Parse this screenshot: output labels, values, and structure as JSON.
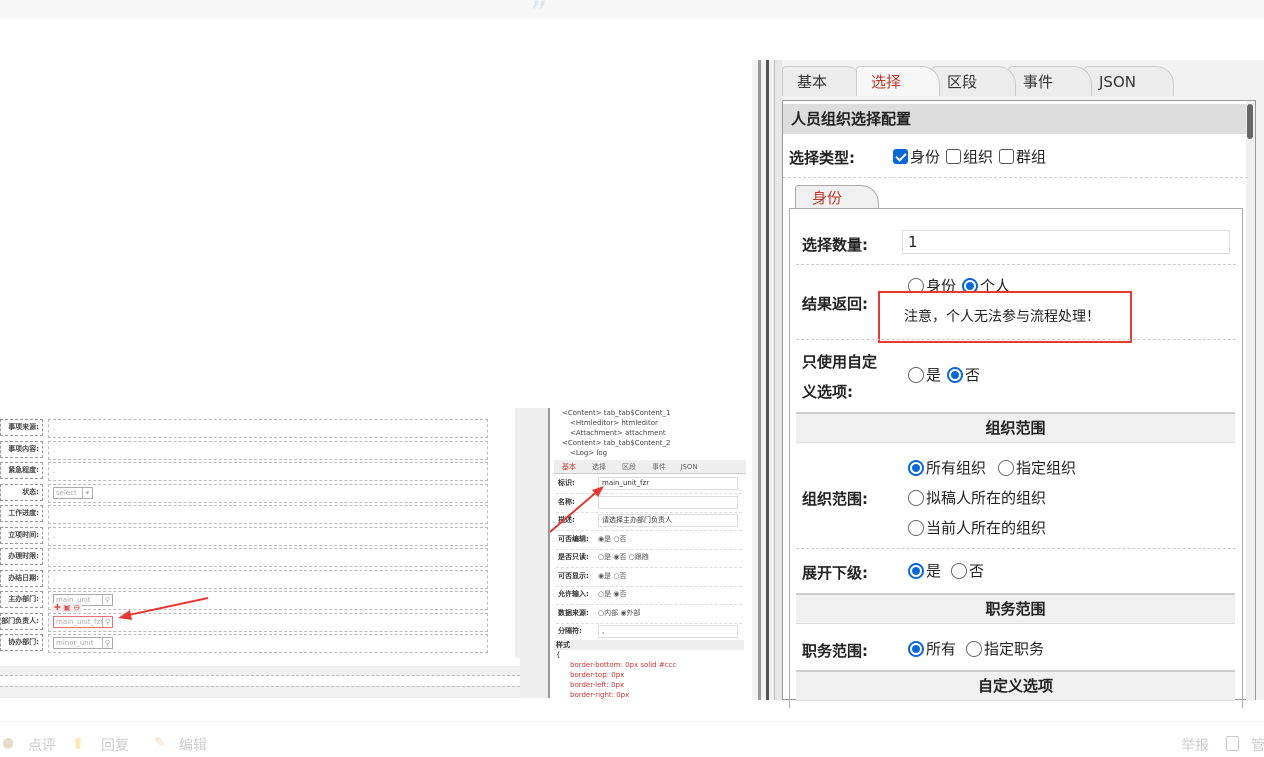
{
  "left_form": {
    "rows": [
      {
        "label": "事项来源:",
        "value": "."
      },
      {
        "label": "事项内容:",
        "value": "."
      },
      {
        "label": "紧急程度:",
        "value": "."
      },
      {
        "label": "状态:",
        "select": "select"
      },
      {
        "label": "工作进度:",
        "value": ""
      },
      {
        "label": "立项时间:",
        "value": "."
      },
      {
        "label": "办理时限:",
        "value": "."
      },
      {
        "label": "办结日期:",
        "value": "."
      },
      {
        "label": "主办部门:",
        "input": "main_unit"
      },
      {
        "label": "部门负责人:",
        "input": "main_unit_fzr"
      },
      {
        "label": "协办部门:",
        "input": "minor_unit"
      }
    ]
  },
  "middle": {
    "tree": [
      "<Content> tab_tab$Content_1",
      "<Htmleditor> htmleditor",
      "<Attachment> attachment",
      "<Content> tab_tab$Content_2",
      "<Log> log"
    ],
    "tabs": [
      "基本",
      "选择",
      "区段",
      "事件",
      "JSON"
    ],
    "rows": [
      {
        "label": "标识:",
        "value": "main_unit_fzr"
      },
      {
        "label": "名称:",
        "value": ""
      },
      {
        "label": "描述:",
        "value": "请选择主办部门负责人"
      },
      {
        "label": "可否编辑:",
        "options": "◉是 ○否"
      },
      {
        "label": "是否只读:",
        "options": "○是 ◉否 ○跟随"
      },
      {
        "label": "可否显示:",
        "options": "◉是 ○否"
      },
      {
        "label": "允许输入:",
        "options": "○是 ◉否"
      },
      {
        "label": "数据来源:",
        "options": "○内部 ◉外部"
      },
      {
        "label": "分隔符:",
        "value": ","
      }
    ],
    "style_title": "样式",
    "style_lines": [
      "{",
      "border-bottom: 0px solid #ccc",
      "border-top: 0px",
      "border-left: 0px",
      "border-right: 0px"
    ]
  },
  "panel": {
    "tabs": [
      "基本",
      "选择",
      "区段",
      "事件",
      "JSON"
    ],
    "active_tab": "选择",
    "header": "人员组织选择配置",
    "select_type_label": "选择类型:",
    "select_types": [
      {
        "label": "身份",
        "checked": true
      },
      {
        "label": "组织",
        "checked": false
      },
      {
        "label": "群组",
        "checked": false
      }
    ],
    "sub_tab": "身份",
    "count_label": "选择数量:",
    "count_value": "1",
    "result_label": "结果返回:",
    "result_options": [
      {
        "label": "身份",
        "checked": false
      },
      {
        "label": "个人",
        "checked": true
      }
    ],
    "notice": "注意，个人无法参与流程处理！",
    "custom_only_label_1": "只使用自定",
    "custom_only_label_2": "义选项:",
    "custom_only_options": [
      {
        "label": "是",
        "checked": false
      },
      {
        "label": "否",
        "checked": true
      }
    ],
    "org_section": "组织范围",
    "org_label": "组织范围:",
    "org_options": [
      {
        "label": "所有组织",
        "checked": true
      },
      {
        "label": "指定组织",
        "checked": false
      },
      {
        "label": "拟稿人所在的组织",
        "checked": false
      },
      {
        "label": "当前人所在的组织",
        "checked": false
      }
    ],
    "expand_label": "展开下级:",
    "expand_options": [
      {
        "label": "是",
        "checked": true
      },
      {
        "label": "否",
        "checked": false
      }
    ],
    "duty_section": "职务范围",
    "duty_label": "职务范围:",
    "duty_options": [
      {
        "label": "所有",
        "checked": true
      },
      {
        "label": "指定职务",
        "checked": false
      }
    ],
    "custom_section": "自定义选项"
  },
  "footer": {
    "comment": "点评",
    "reply": "回复",
    "edit": "编辑",
    "report": "举报",
    "manage": "管"
  },
  "colors": {
    "accent": "#0a67d8",
    "highlight_red": "#e53935",
    "active_tab_text": "#c0392b"
  }
}
